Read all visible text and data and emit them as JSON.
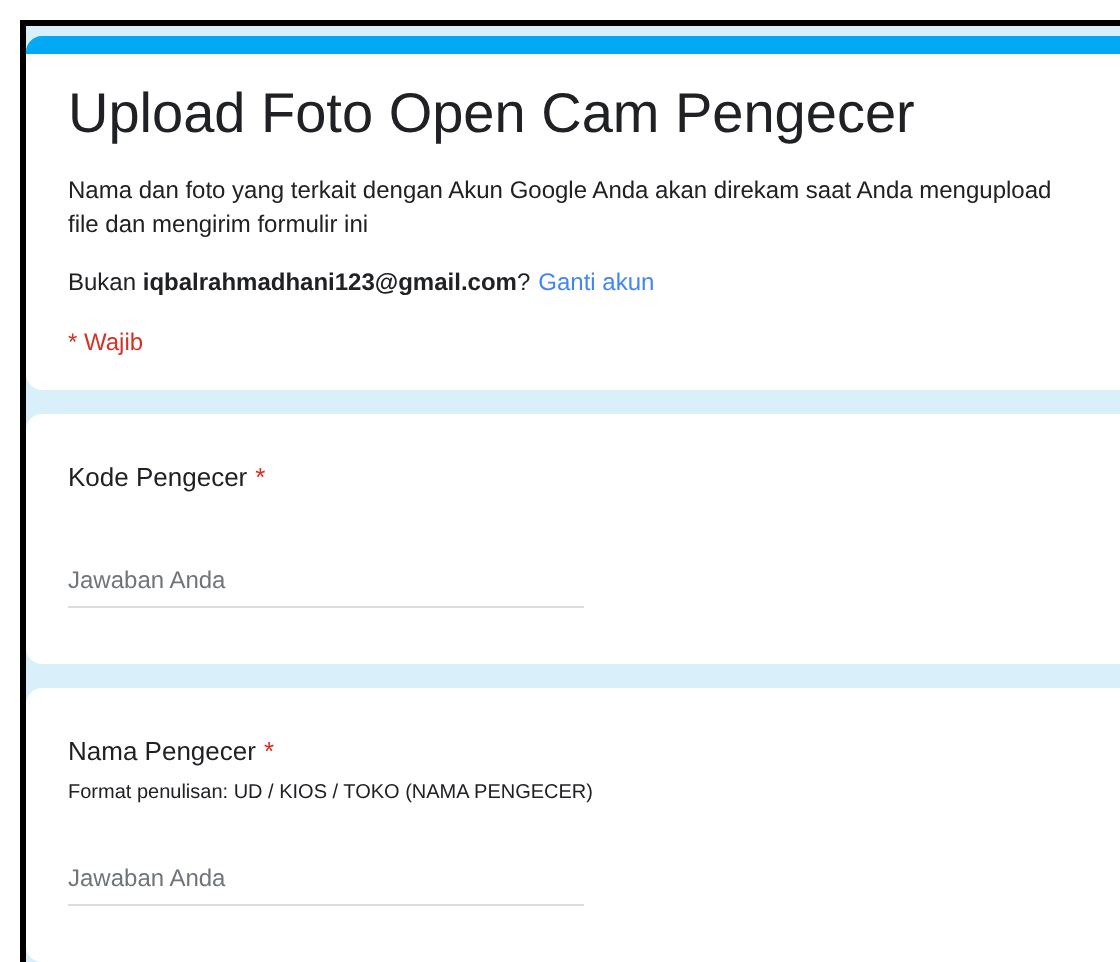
{
  "form": {
    "title": "Upload Foto Open Cam Pengecer",
    "notice": "Nama dan foto yang terkait dengan Akun Google Anda akan direkam saat Anda mengupload file dan mengirim formulir ini",
    "account_prefix": "Bukan **iqbalrahmadhani123@gmail.com**?",
    "switch_account": "Ganti akun",
    "required_note": "* Wajib"
  },
  "questions": [
    {
      "label": "Kode Pengecer",
      "required_mark": "*",
      "placeholder": "Jawaban Anda"
    },
    {
      "label": "Nama Pengecer",
      "required_mark": "*",
      "description": "Format penulisan: UD / KIOS / TOKO (NAMA PENGECER)",
      "placeholder": "Jawaban Anda"
    }
  ]
}
